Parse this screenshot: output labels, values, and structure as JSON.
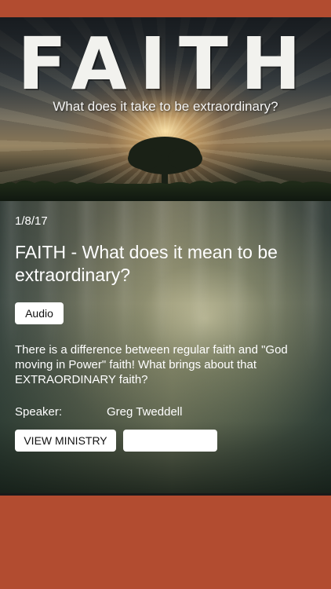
{
  "colors": {
    "brand_orange": "#b24c30",
    "button_bg": "#ffffff",
    "text_light": "#ffffff"
  },
  "hero": {
    "title": "FAITH",
    "subtitle": "What does it take to be extraordinary?"
  },
  "sermon": {
    "date": "1/8/17",
    "title": "FAITH - What does it mean to be extraordinary?",
    "audio_button": "Audio",
    "description": "There is a difference between regular faith and \"God moving in Power\" faith!  What brings about that EXTRAORDINARY faith?",
    "speaker_label": "Speaker:",
    "speaker_name": "Greg Tweddell",
    "view_ministry_button": "VIEW MINISTRY",
    "secondary_button": ""
  }
}
